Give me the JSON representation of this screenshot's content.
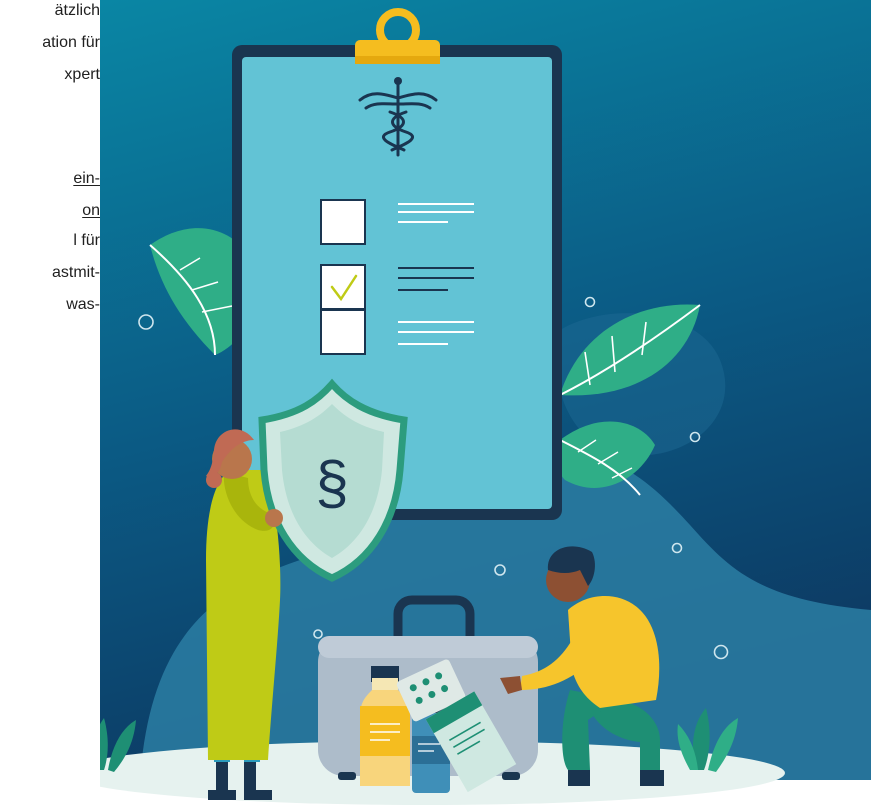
{
  "article": {
    "lines": [
      {
        "text": "ätzlich",
        "link": false
      },
      {
        "text": "ation für",
        "link": false
      },
      {
        "text": "xpert",
        "link": false
      },
      {
        "text": "ein-",
        "link": true
      },
      {
        "text": "on ",
        "link": true
      },
      {
        "text": "l für",
        "link": false
      },
      {
        "text": "astmit-",
        "link": false
      },
      {
        "text": "was-",
        "link": false
      }
    ]
  },
  "illustration": {
    "shield_symbol": "§",
    "icons": [
      "caduceus-icon",
      "checkbox-icon",
      "checkmark-icon",
      "shield-icon",
      "leaf-icon",
      "medicine-case-icon",
      "bottle-icon",
      "pill-blister-icon"
    ],
    "colors": {
      "background_top": "#0a86a4",
      "background_bottom": "#0d3a63",
      "clipboard_frame": "#1a3550",
      "clipboard_paper": "#62c3d5",
      "clip": "#f5bd1f",
      "leaf": "#2fae87",
      "shield_fill": "#cfe8e1",
      "shield_border": "#2c9c7e",
      "ground": "#e6f2ef",
      "woman_dress": "#bfcb16",
      "man_shirt": "#f6c52c",
      "man_pants": "#1e8f74",
      "case": "#adbcca"
    }
  }
}
